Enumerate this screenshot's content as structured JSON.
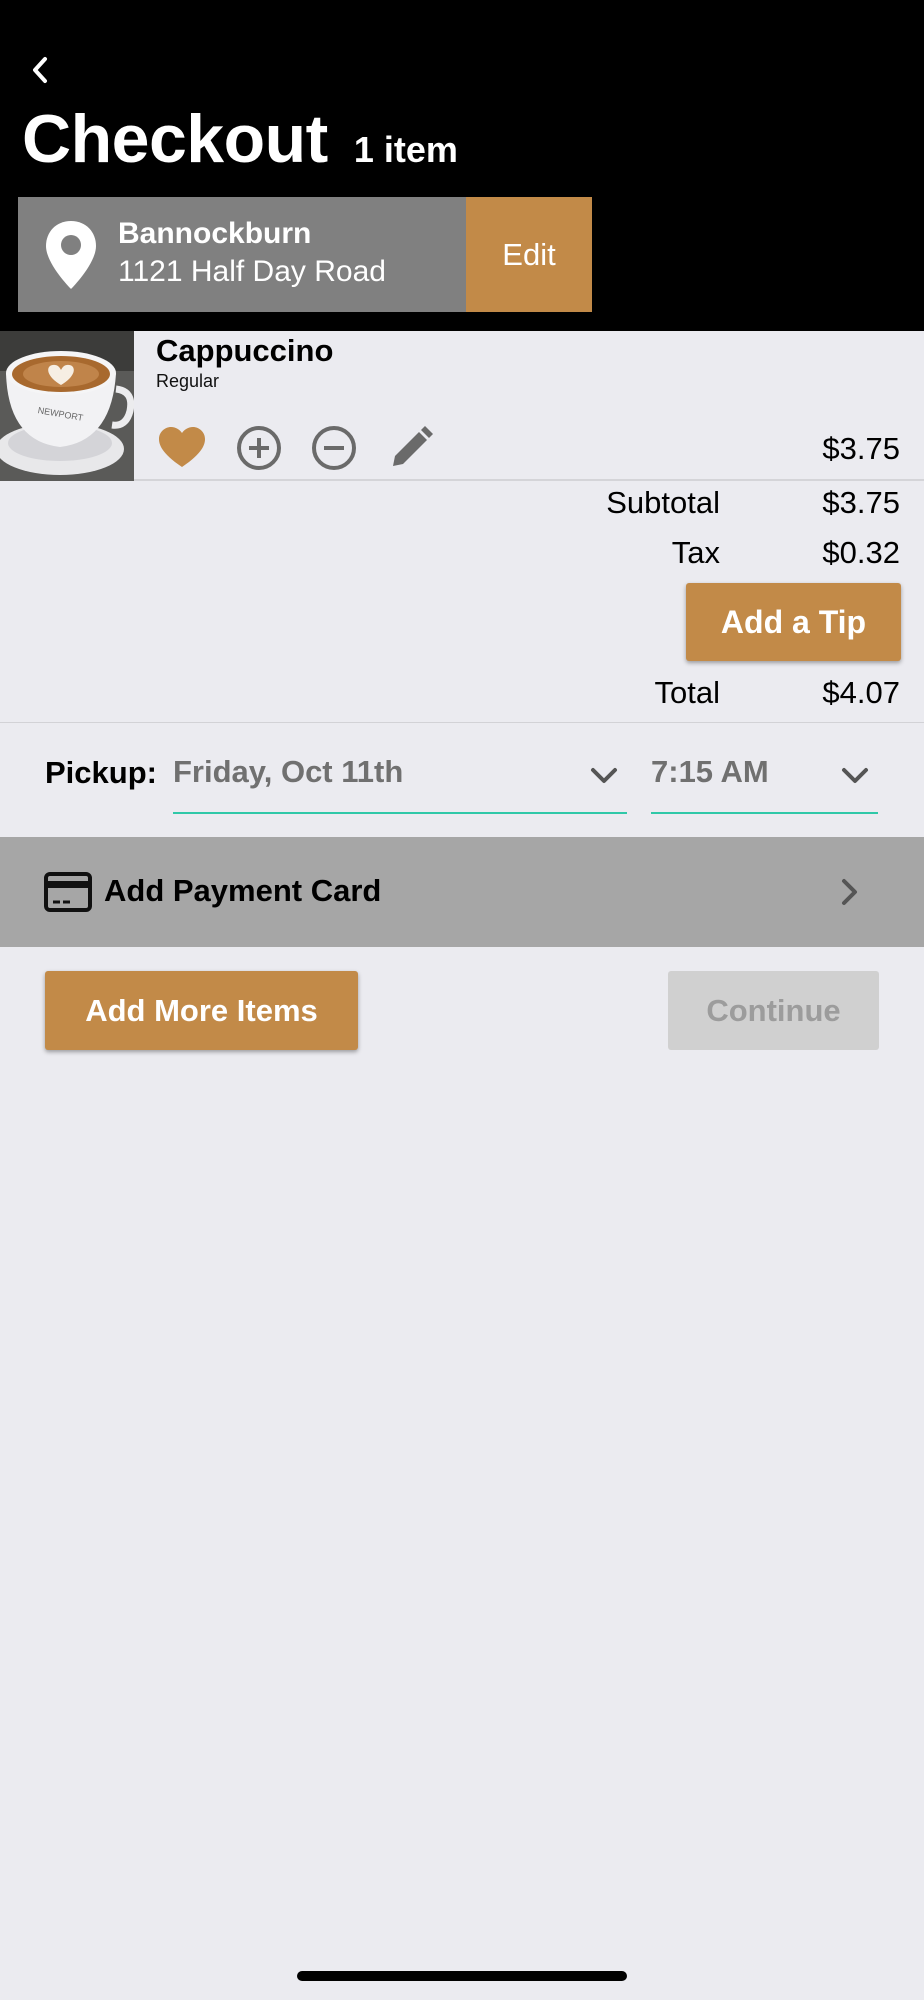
{
  "header": {
    "title": "Checkout",
    "item_count": "1 item"
  },
  "location": {
    "store_name": "Bannockburn",
    "address": "1121 Half Day Road",
    "edit_label": "Edit"
  },
  "cart": {
    "items": [
      {
        "name": "Cappuccino",
        "variant": "Regular",
        "price": "$3.75"
      }
    ]
  },
  "totals": {
    "subtotal_label": "Subtotal",
    "subtotal_value": "$3.75",
    "tax_label": "Tax",
    "tax_value": "$0.32",
    "tip_button_label": "Add a Tip",
    "total_label": "Total",
    "total_value": "$4.07"
  },
  "pickup": {
    "label": "Pickup:",
    "date_value": "Friday, Oct 11th",
    "time_value": "7:15 AM"
  },
  "payment": {
    "label": "Add Payment Card"
  },
  "actions": {
    "add_more_label": "Add More Items",
    "continue_label": "Continue"
  },
  "colors": {
    "accent": "#c28a48",
    "dropdown_underline": "#2fc8a8",
    "disabled_button": "#d0d0d0"
  }
}
